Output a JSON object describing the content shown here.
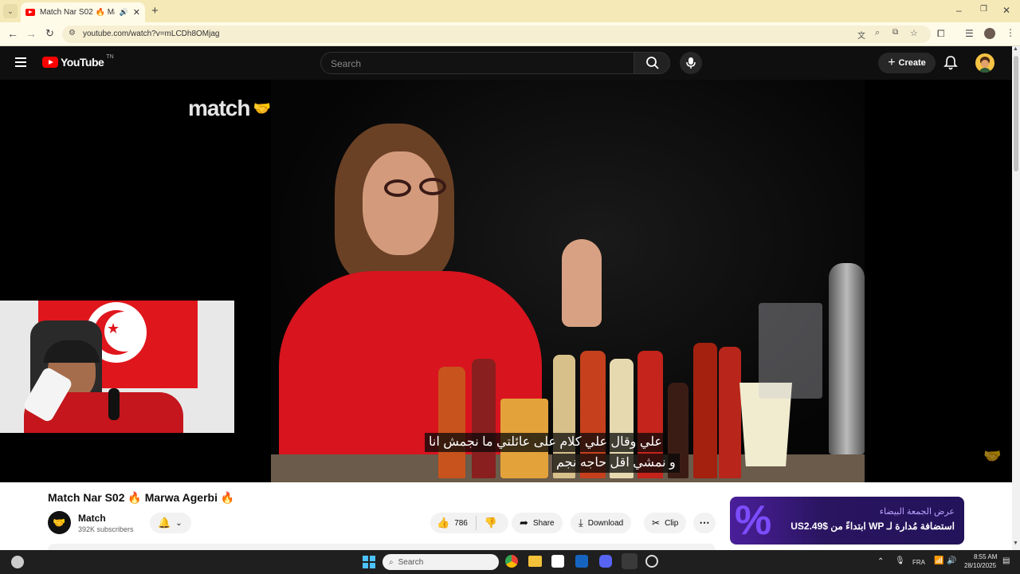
{
  "browser": {
    "tab_title": "Match Nar S02 🔥 Marwa A",
    "url": "youtube.com/watch?v=mLCDh8OMjag",
    "new_tab": "+"
  },
  "youtube": {
    "logo_text": "YouTube",
    "logo_region": "TN",
    "search_placeholder": "Search",
    "create_label": "Create"
  },
  "video": {
    "watermark": "match",
    "subtitle_line1": "علي وقال علي كلام على عائلتي ما نجمش انا",
    "subtitle_line2": "و نمشي اقل حاجه نجم"
  },
  "details": {
    "title": "Match Nar S02 🔥 Marwa Agerbi 🔥",
    "channel_name": "Match",
    "subscribers": "392K subscribers",
    "likes": "786",
    "share_label": "Share",
    "download_label": "Download",
    "clip_label": "Clip"
  },
  "ad": {
    "line1": "عرض الجمعة البيضاء",
    "line2": "استضافة مُدارة لـ WP ابتداءً من US2.49$"
  },
  "taskbar": {
    "search_placeholder": "Search",
    "language": "FRA",
    "time": "8:55 AM",
    "date": "28/10/2025"
  },
  "colors": {
    "yt_red": "#ff0000",
    "tab_strip": "#f5e9b8",
    "subtitle_bg": "rgba(8,8,8,0.75)",
    "ad_purple": "#3a1c78"
  }
}
